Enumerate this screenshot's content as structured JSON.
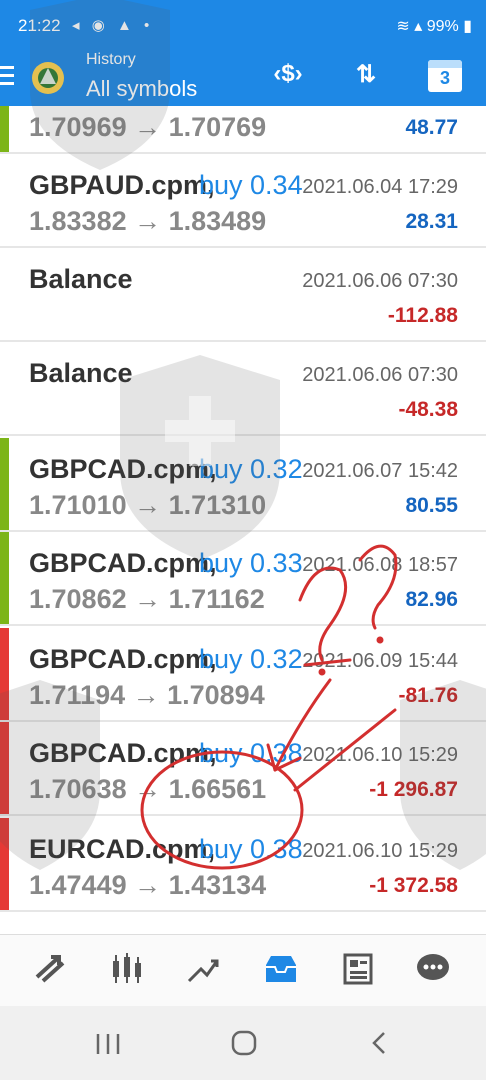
{
  "status": {
    "time": "21:22",
    "battery": "99%"
  },
  "header": {
    "subtitle": "History",
    "title": "All symbols",
    "calendar_day": "3"
  },
  "colors": {
    "primary": "#1e88e5",
    "profit": "#1565c0",
    "loss": "#c62828",
    "buy_bar": "#7cb518",
    "sell_bar": "#e53935"
  },
  "rows": [
    {
      "symbol": "",
      "deal": "",
      "datetime": "",
      "prices": "1.70969 → 1.70769",
      "profit": "48.77",
      "kind": "profit"
    },
    {
      "symbol": "GBPAUD.cpm,",
      "deal": "buy 0.34",
      "datetime": "2021.06.04 17:29",
      "prices": "1.83382 → 1.83489",
      "profit": "28.31",
      "kind": "profit"
    },
    {
      "symbol": "Balance",
      "deal": "",
      "datetime": "2021.06.06 07:30",
      "prices": "",
      "profit": "-112.88",
      "kind": "loss"
    },
    {
      "symbol": "Balance",
      "deal": "",
      "datetime": "2021.06.06 07:30",
      "prices": "",
      "profit": "-48.38",
      "kind": "loss"
    },
    {
      "symbol": "GBPCAD.cpm,",
      "deal": "buy 0.32",
      "datetime": "2021.06.07 15:42",
      "prices": "1.71010 → 1.71310",
      "profit": "80.55",
      "kind": "profit"
    },
    {
      "symbol": "GBPCAD.cpm,",
      "deal": "buy 0.33",
      "datetime": "2021.06.08 18:57",
      "prices": "1.70862 → 1.71162",
      "profit": "82.96",
      "kind": "profit"
    },
    {
      "symbol": "GBPCAD.cpm,",
      "deal": "buy 0.32",
      "datetime": "2021.06.09 15:44",
      "prices": "1.71194 → 1.70894",
      "profit": "-81.76",
      "kind": "loss"
    },
    {
      "symbol": "GBPCAD.cpm,",
      "deal": "buy 0.38",
      "datetime": "2021.06.10 15:29",
      "prices": "1.70638 → 1.66561",
      "profit": "-1 296.87",
      "kind": "loss"
    },
    {
      "symbol": "EURCAD.cpm,",
      "deal": "buy 0.38",
      "datetime": "2021.06.10 15:29",
      "prices": "1.47449 → 1.43134",
      "profit": "-1 372.58",
      "kind": "loss"
    }
  ],
  "bottom_nav": [
    {
      "name": "quotes-icon"
    },
    {
      "name": "chart-icon"
    },
    {
      "name": "trade-icon"
    },
    {
      "name": "history-icon",
      "active": true
    },
    {
      "name": "news-icon"
    },
    {
      "name": "chat-icon"
    }
  ]
}
